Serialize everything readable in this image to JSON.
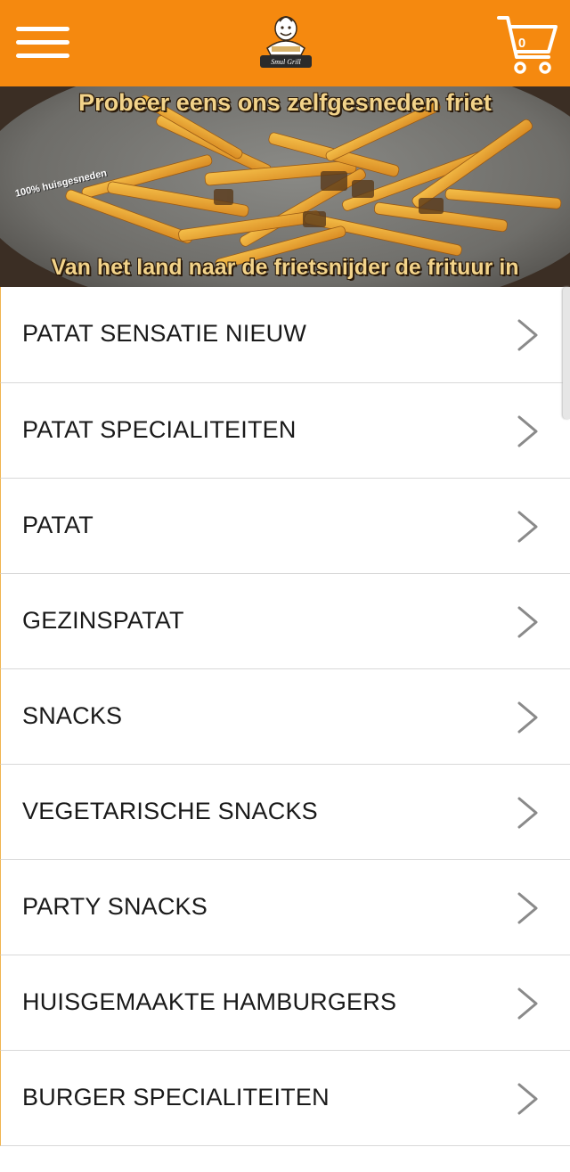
{
  "header": {
    "menu_icon": "hamburger-menu-icon",
    "logo_icon": "restaurant-logo-icon",
    "logo_text": "Smul Grill",
    "cart_icon": "shopping-cart-icon",
    "cart_count": "0",
    "background_color": "#f5890f"
  },
  "hero": {
    "top_text": "Probeer eens ons zelfgesneden friet",
    "badge_text": "100% huisgesneden",
    "bottom_text": "Van het land naar de frietsnijder de frituur in"
  },
  "categories": [
    {
      "label": "PATAT SENSATIE NIEUW"
    },
    {
      "label": "PATAT SPECIALITEITEN"
    },
    {
      "label": "PATAT"
    },
    {
      "label": "GEZINSPATAT"
    },
    {
      "label": "SNACKS"
    },
    {
      "label": "VEGETARISCHE SNACKS"
    },
    {
      "label": "PARTY SNACKS"
    },
    {
      "label": "HUISGEMAAKTE HAMBURGERS"
    },
    {
      "label": "BURGER SPECIALITEITEN"
    }
  ],
  "chevron_icon": "chevron-right-icon"
}
